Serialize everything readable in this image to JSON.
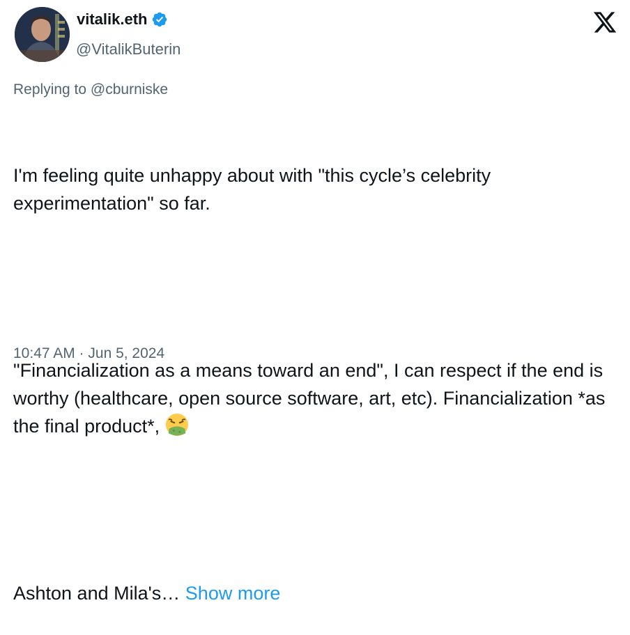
{
  "author": {
    "display_name": "vitalik.eth",
    "handle": "@VitalikButerin",
    "verified_color": "#1d9bf0"
  },
  "reply_context": {
    "text": "Replying to @cburniske"
  },
  "tweet": {
    "paragraph_1": "I'm feeling quite unhappy about with \"this cycle’s celebrity experimentation\" so far.",
    "paragraph_2": "\"Financialization as a means toward an end\", I can respect if the end is worthy (healthcare, open source software, art, etc). Financialization *as the final product*,",
    "paragraph_3_truncated": "Ashton and Mila's…",
    "show_more_label": "Show more",
    "emoji": "nauseated-face-emoji"
  },
  "timestamp": "10:47 AM · Jun 5, 2024",
  "icons": {
    "close": "x-logo-icon",
    "verified": "verified-badge-icon"
  },
  "colors": {
    "text": "#0f1419",
    "secondary": "#536471",
    "link": "#1d9bf0"
  }
}
